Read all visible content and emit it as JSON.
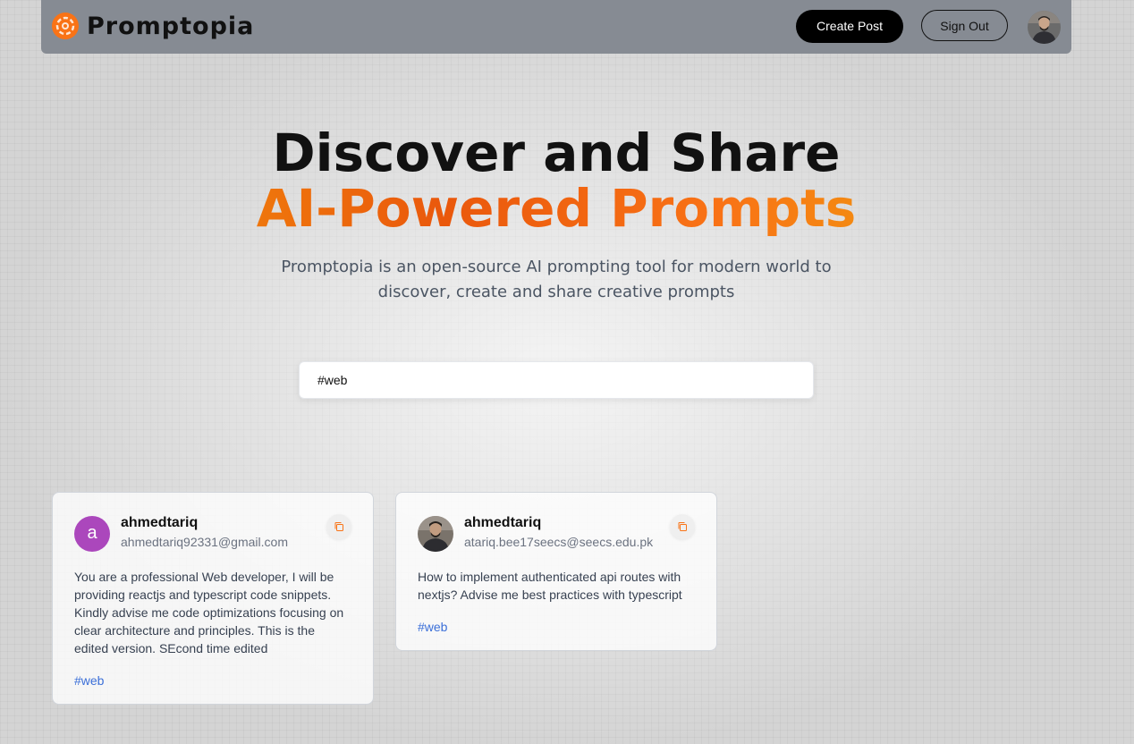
{
  "nav": {
    "brand": "Promptopia",
    "create_post_label": "Create Post",
    "sign_out_label": "Sign Out"
  },
  "hero": {
    "title_line1": "Discover and Share",
    "title_line2": "AI-Powered Prompts",
    "subtitle": "Promptopia is an open-source AI prompting tool for modern world to discover, create and share creative prompts"
  },
  "search": {
    "value": "#web",
    "placeholder": ""
  },
  "prompts": [
    {
      "avatar_letter": "a",
      "username": "ahmedtariq",
      "email": "ahmedtariq92331@gmail.com",
      "text": "You are a professional Web developer, I will be providing reactjs and typescript code snippets. Kindly advise me code optimizations focusing on clear architecture and principles. This is the edited version. SEcond time edited",
      "tag": "#web"
    },
    {
      "username": "ahmedtariq",
      "email": "atariq.bee17seecs@seecs.edu.pk",
      "text": "How to implement authenticated api routes with nextjs? Advise me best practices with typescript",
      "tag": "#web"
    }
  ],
  "colors": {
    "brand_accent": "#f97316",
    "tag_color": "#3b6fd8",
    "avatar_letter_bg": "#ab47bc"
  },
  "icons": {
    "logo": "logo-icon",
    "copy": "copy-icon"
  }
}
